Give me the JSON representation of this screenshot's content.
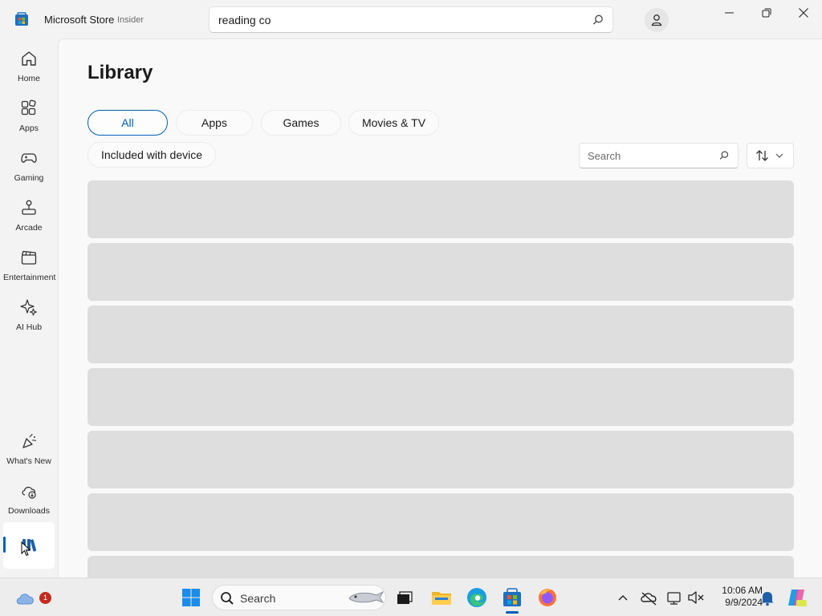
{
  "titlebar": {
    "app_title": "Microsoft Store",
    "badge": "Insider",
    "search_value": "reading co"
  },
  "sidebar": {
    "items": [
      {
        "label": "Home",
        "icon": "home-icon"
      },
      {
        "label": "Apps",
        "icon": "apps-icon"
      },
      {
        "label": "Gaming",
        "icon": "gaming-icon"
      },
      {
        "label": "Arcade",
        "icon": "arcade-icon"
      },
      {
        "label": "Entertainment",
        "icon": "entertainment-icon"
      },
      {
        "label": "AI Hub",
        "icon": "ai-hub-icon"
      },
      {
        "label": "What's New",
        "icon": "whats-new-icon"
      },
      {
        "label": "Downloads",
        "icon": "downloads-icon"
      },
      {
        "label": "",
        "icon": "library-icon"
      }
    ]
  },
  "library": {
    "title": "Library",
    "filters": [
      "All",
      "Apps",
      "Games",
      "Movies & TV",
      "Included with device"
    ],
    "selected_filter": "All",
    "search_placeholder": "Search"
  },
  "taskbar": {
    "search_placeholder": "Search",
    "time": "10:06 AM",
    "date": "9/9/2024",
    "weather_badge": "1"
  },
  "colors": {
    "accent": "#005fb8",
    "placeholder_row": "#dedede"
  }
}
